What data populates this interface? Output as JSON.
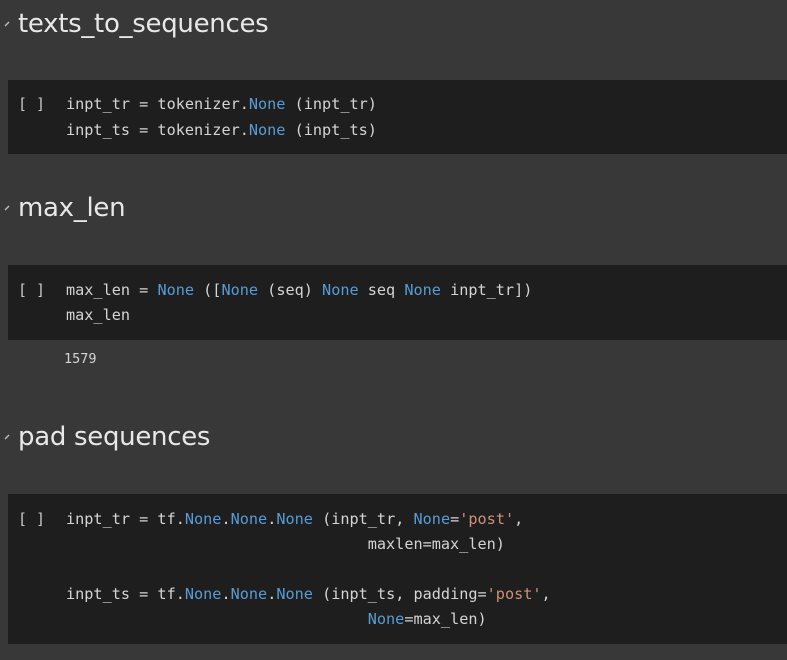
{
  "sections": [
    {
      "heading": "texts_to_sequences"
    },
    {
      "heading": "max_len"
    },
    {
      "heading": "pad sequences"
    }
  ],
  "cells": [
    {
      "run_indicator": "[ ]",
      "lines": [
        [
          {
            "t": "inpt_tr = tokenizer."
          },
          {
            "t": "None",
            "k": "kw"
          },
          {
            "t": " (inpt_tr)"
          }
        ],
        [
          {
            "t": "inpt_ts = tokenizer."
          },
          {
            "t": "None",
            "k": "kw"
          },
          {
            "t": " (inpt_ts)"
          }
        ]
      ]
    },
    {
      "run_indicator": "[ ]",
      "lines": [
        [
          {
            "t": "max_len = "
          },
          {
            "t": "None",
            "k": "kw"
          },
          {
            "t": " (["
          },
          {
            "t": "None",
            "k": "kw"
          },
          {
            "t": " (seq) "
          },
          {
            "t": "None",
            "k": "kw"
          },
          {
            "t": " seq "
          },
          {
            "t": "None",
            "k": "kw"
          },
          {
            "t": " inpt_tr])"
          }
        ],
        [
          {
            "t": "max_len"
          }
        ]
      ],
      "output": "1579"
    },
    {
      "run_indicator": "[ ]",
      "lines": [
        [
          {
            "t": "inpt_tr = tf."
          },
          {
            "t": "None",
            "k": "kw"
          },
          {
            "t": "."
          },
          {
            "t": "None",
            "k": "kw"
          },
          {
            "t": "."
          },
          {
            "t": "None",
            "k": "kw"
          },
          {
            "t": " (inpt_tr, "
          },
          {
            "t": "None",
            "k": "kw"
          },
          {
            "t": "="
          },
          {
            "t": "'post'",
            "k": "str"
          },
          {
            "t": ","
          }
        ],
        [
          {
            "t": "                                 maxlen=max_len)"
          }
        ],
        [
          {
            "t": ""
          }
        ],
        [
          {
            "t": "inpt_ts = tf."
          },
          {
            "t": "None",
            "k": "kw"
          },
          {
            "t": "."
          },
          {
            "t": "None",
            "k": "kw"
          },
          {
            "t": "."
          },
          {
            "t": "None",
            "k": "kw"
          },
          {
            "t": " (inpt_ts, padding="
          },
          {
            "t": "'post'",
            "k": "str"
          },
          {
            "t": ","
          }
        ],
        [
          {
            "t": "                                 "
          },
          {
            "t": "None",
            "k": "kw"
          },
          {
            "t": "=max_len)"
          }
        ]
      ]
    }
  ],
  "colors": {
    "background": "#383838",
    "cell_background": "#1e1e1e",
    "keyword": "#569cd6",
    "string": "#ce9178",
    "text": "#d4d4d4"
  },
  "icons": {
    "section_toggle": "chevron-down-icon"
  }
}
